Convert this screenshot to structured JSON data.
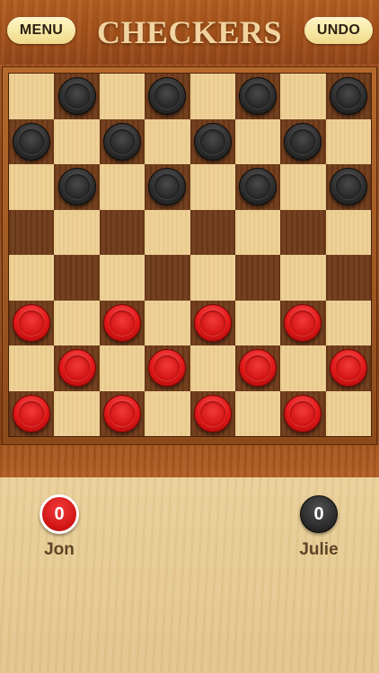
{
  "header": {
    "menu_label": "MENU",
    "title": "CHECKERS",
    "undo_label": "UNDO"
  },
  "board": {
    "size": 8,
    "light_color": "#edcf92",
    "dark_color": "#6f3b19",
    "rows": [
      [
        null,
        "black",
        null,
        "black",
        null,
        "black",
        null,
        "black"
      ],
      [
        "black",
        null,
        "black",
        null,
        "black",
        null,
        "black",
        null
      ],
      [
        null,
        "black",
        null,
        "black",
        null,
        "black",
        null,
        "black"
      ],
      [
        null,
        null,
        null,
        null,
        null,
        null,
        null,
        null
      ],
      [
        null,
        null,
        null,
        null,
        null,
        null,
        null,
        null
      ],
      [
        "red",
        null,
        "red",
        null,
        "red",
        null,
        "red",
        null
      ],
      [
        null,
        "red",
        null,
        "red",
        null,
        "red",
        null,
        "red"
      ],
      [
        "red",
        null,
        "red",
        null,
        "red",
        null,
        "red",
        null
      ]
    ]
  },
  "players": {
    "left": {
      "name": "Jon",
      "score": "0",
      "color": "red"
    },
    "right": {
      "name": "Julie",
      "score": "0",
      "color": "black"
    }
  },
  "colors": {
    "red_piece": "#e01818",
    "black_piece": "#2f2f2f",
    "button_bg": "#f6e6a0"
  }
}
